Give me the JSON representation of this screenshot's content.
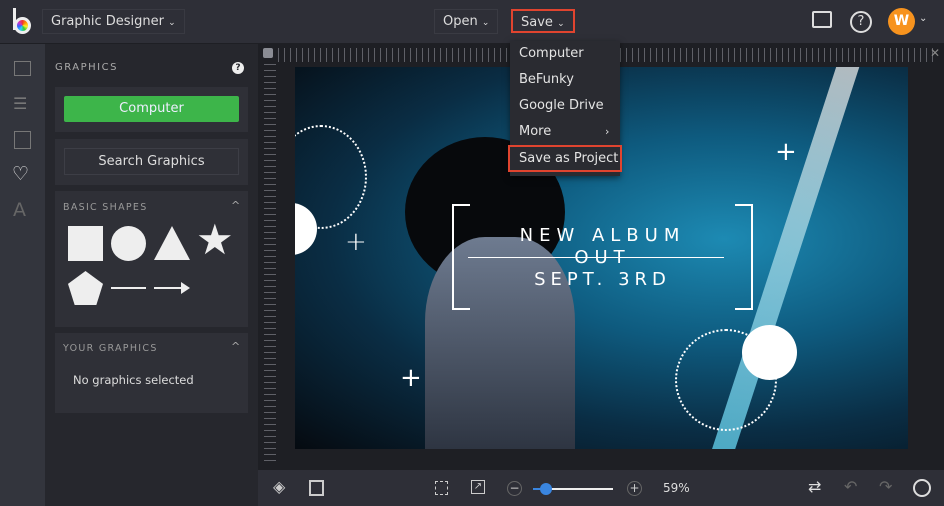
{
  "header": {
    "app_mode": "Graphic Designer",
    "open_label": "Open",
    "save_label": "Save",
    "avatar_initial": "W",
    "accent": "#f7931e"
  },
  "save_menu": {
    "items": [
      "Computer",
      "BeFunky",
      "Google Drive",
      "More",
      "Save as Project"
    ],
    "highlighted": "Save as Project"
  },
  "sidebar": {
    "title": "GRAPHICS",
    "computer_button": "Computer",
    "search_button": "Search Graphics",
    "basic_shapes_title": "BASIC SHAPES",
    "your_graphics_title": "YOUR GRAPHICS",
    "your_graphics_empty": "No graphics selected",
    "button_color": "#3db54a"
  },
  "canvas": {
    "line1": "NEW ALBUM",
    "line2": "OUT",
    "line3": "SEPT. 3RD"
  },
  "bottom": {
    "zoom_label": "59%",
    "zoom_percent": 59
  }
}
